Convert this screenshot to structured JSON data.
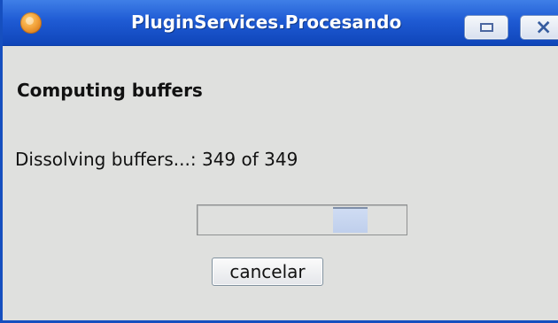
{
  "window": {
    "title": "PluginServices.Procesando"
  },
  "dialog": {
    "heading": "Computing buffers",
    "status_text": "Dissolving buffers...: 349 of 349",
    "progress": {
      "indeterminate": true,
      "indicator_offset_fraction": 0.66,
      "indicator_width_fraction": 0.17
    },
    "cancel_label": "cancelar"
  },
  "icons": {
    "app": "java-app-icon",
    "restore": "restore-icon",
    "close": "close-icon"
  },
  "colors": {
    "titlebar": "#1f5bd4",
    "dialog_background": "#dfe0de",
    "progress_indicator": "#c5d4ef"
  }
}
